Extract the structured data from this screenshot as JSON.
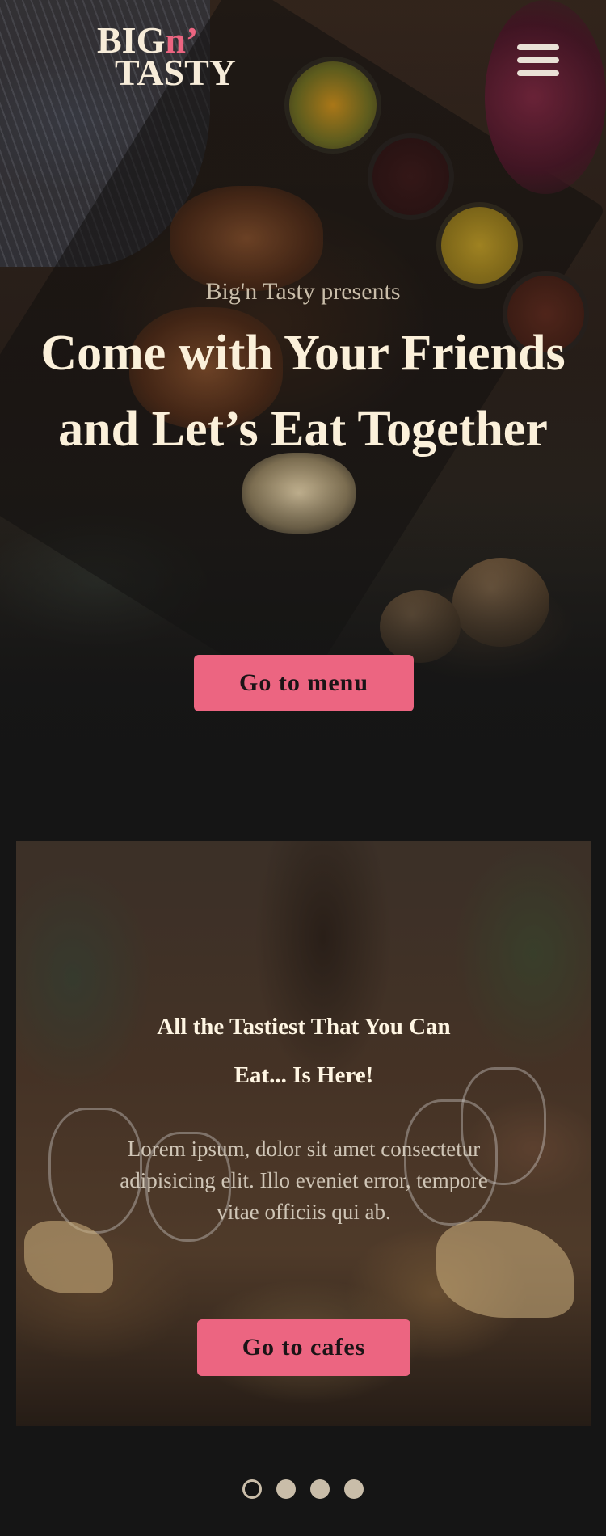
{
  "brand": {
    "logo_line1_main": "BIG",
    "logo_line1_accent": "n’",
    "logo_line2": "TASTY",
    "accent_color": "#ec6581",
    "text_color": "#fbf0da"
  },
  "header": {
    "menu_icon": "hamburger-menu-icon"
  },
  "hero": {
    "subtitle": "Big'n Tasty presents",
    "title_line1": "Come with Your Friends",
    "title_line2": "and Let’s Eat Together",
    "cta_label": "Go to menu"
  },
  "cafe": {
    "title_line1": "All the Tastiest That You Can",
    "title_line2": "Eat... Is Here!",
    "description": "Lorem ipsum, dolor sit amet consectetur adipisicing elit. Illo eveniet error, tempore vitae officiis qui ab.",
    "cta_label": "Go to cafes"
  },
  "carousel": {
    "total": 4,
    "active_index": 0
  }
}
